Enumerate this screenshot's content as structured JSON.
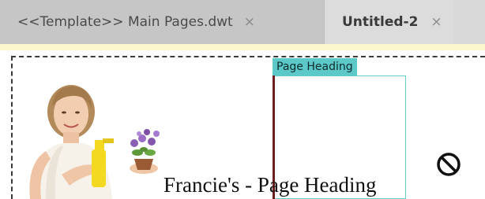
{
  "tabs": [
    {
      "label": "<<Template>> Main Pages.dwt",
      "close": "×",
      "active": false
    },
    {
      "label": "Untitled-2",
      "close": "×",
      "active": true
    }
  ],
  "canvas": {
    "editable_region_label": "Page Heading",
    "heading_text": "Francie's - Page Heading",
    "figure_icon": "woman-spraying-plant-image",
    "not_allowed_icon": "no-drop-icon"
  },
  "colors": {
    "tab_inactive": "#c6c6c6",
    "tab_active": "#dcdcdc",
    "region_accent": "#5cc8c8",
    "highlight_strip": "#fcf7cc"
  }
}
